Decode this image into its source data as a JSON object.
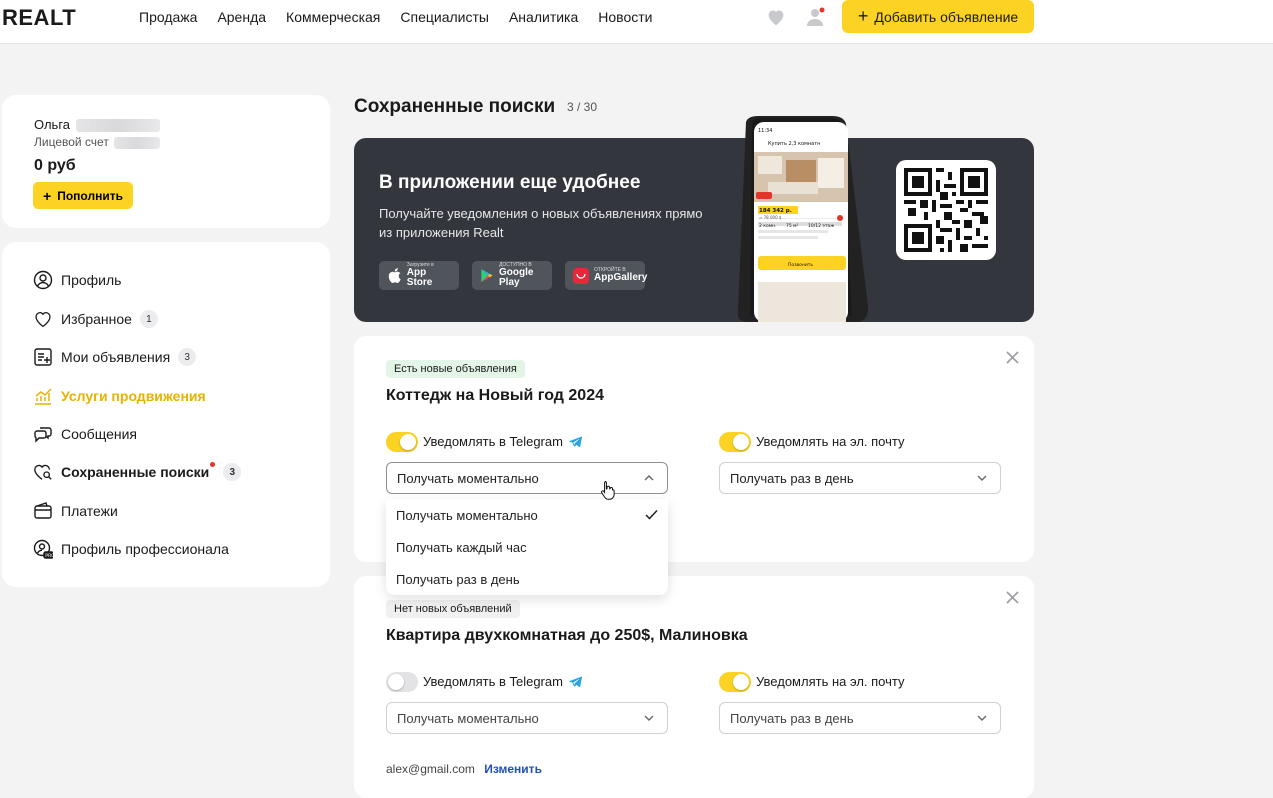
{
  "header": {
    "logo": "REALT",
    "nav": [
      "Продажа",
      "Аренда",
      "Коммерческая",
      "Специалисты",
      "Аналитика",
      "Новости"
    ],
    "add_button": "Добавить объявление",
    "icons": [
      "heart-icon",
      "user-icon"
    ],
    "accent": "#fdd323"
  },
  "user": {
    "name": "Ольга",
    "account_label": "Лицевой счет",
    "balance": "0 руб",
    "topup_label": "Пополнить"
  },
  "menu": {
    "items": [
      {
        "label": "Профиль",
        "icon": "user-circle-icon"
      },
      {
        "label": "Избранное",
        "badge": "1",
        "icon": "heart-icon"
      },
      {
        "label": "Мои объявления",
        "badge": "3",
        "icon": "list-add-icon"
      },
      {
        "label": "Услуги продвижения",
        "icon": "chart-icon"
      },
      {
        "label": "Сообщения",
        "icon": "chat-icon"
      },
      {
        "label": "Сохраненные поиски",
        "badge": "3",
        "icon": "heart-search-icon"
      },
      {
        "label": "Платежи",
        "icon": "wallet-icon"
      },
      {
        "label": "Профиль профессионала",
        "icon": "pro-user-icon"
      }
    ],
    "active_color": "#e8b200"
  },
  "main": {
    "title": "Сохраненные поиски",
    "count": "3 / 30"
  },
  "banner": {
    "title": "В приложении еще удобнее",
    "text": "Получайте уведомления о новых объявлениях прямо из приложения Realt",
    "stores": [
      {
        "small": "Загрузите в",
        "big": "App Store"
      },
      {
        "small": "ДОСТУПНО В",
        "big": "Google Play"
      },
      {
        "small": "ОТКРОЙТЕ В",
        "big": "AppGallery"
      }
    ],
    "phone": {
      "time": "11:34",
      "header": "Купить 2,3 комнатн",
      "price": "184 342 р.",
      "price_sub": "≈ 78 000 $",
      "rooms": "2 комн.",
      "area": "75 м²",
      "floor": "10/12 этаж",
      "button": "Позвонить"
    }
  },
  "searches": [
    {
      "status": "Есть новые объявления",
      "title": "Коттедж на Новый год 2024",
      "telegram_label": "Уведомлять в Telegram",
      "telegram_on": true,
      "telegram_select": "Получать моментально",
      "email_label": "Уведомлять на эл. почту",
      "email_on": true,
      "email_select": "Получать раз в день"
    },
    {
      "status": "Нет новых объявлений",
      "title": "Квартира двухкомнатная до 250$, Малиновка",
      "telegram_label": "Уведомлять в Telegram",
      "telegram_on": false,
      "telegram_select": "Получать моментально",
      "email_label": "Уведомлять на эл. почту",
      "email_on": true,
      "email_select": "Получать раз в день",
      "email": "alex@gmail.com",
      "change_label": "Изменить"
    }
  ],
  "dropdown": {
    "options": [
      "Получать моментально",
      "Получать каждый час",
      "Получать раз в день"
    ],
    "selected": "Получать моментально"
  }
}
